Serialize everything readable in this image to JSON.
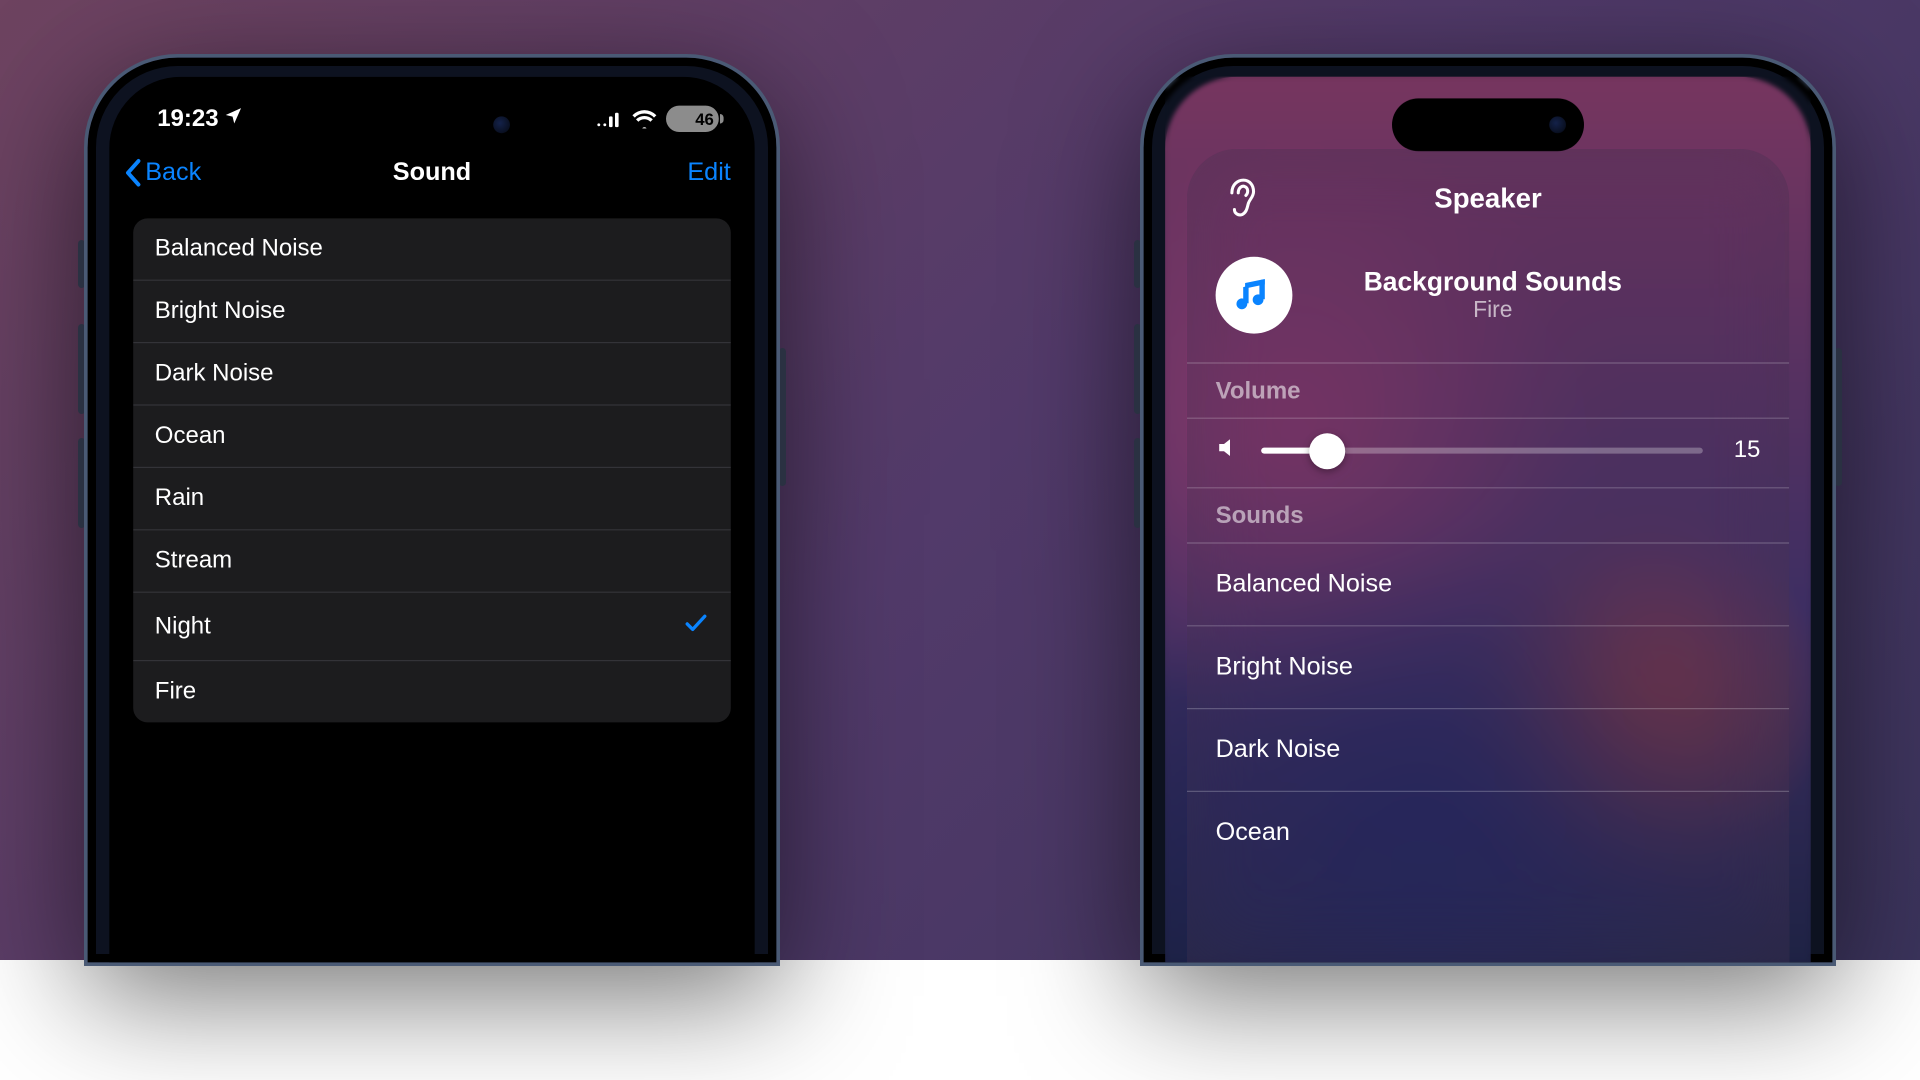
{
  "left": {
    "status": {
      "time": "19:23",
      "battery_pct": "46"
    },
    "nav": {
      "back_label": "Back",
      "title": "Sound",
      "edit_label": "Edit"
    },
    "sounds": [
      {
        "label": "Balanced Noise",
        "selected": false
      },
      {
        "label": "Bright Noise",
        "selected": false
      },
      {
        "label": "Dark Noise",
        "selected": false
      },
      {
        "label": "Ocean",
        "selected": false
      },
      {
        "label": "Rain",
        "selected": false
      },
      {
        "label": "Stream",
        "selected": false
      },
      {
        "label": "Night",
        "selected": true
      },
      {
        "label": "Fire",
        "selected": false
      }
    ]
  },
  "right": {
    "title": "Speaker",
    "now_playing": {
      "title": "Background Sounds",
      "subtitle": "Fire"
    },
    "volume": {
      "label": "Volume",
      "value": "15",
      "pct": 15
    },
    "sounds_label": "Sounds",
    "sounds": [
      {
        "label": "Balanced Noise"
      },
      {
        "label": "Bright Noise"
      },
      {
        "label": "Dark Noise"
      },
      {
        "label": "Ocean"
      }
    ]
  }
}
